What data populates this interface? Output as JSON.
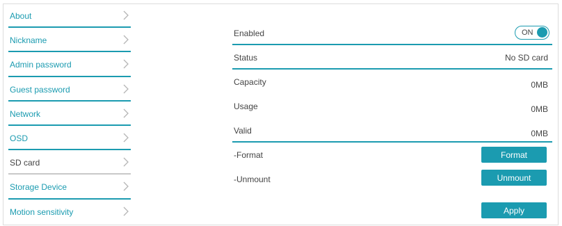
{
  "sidebar": {
    "items": [
      {
        "label": "About",
        "active": false
      },
      {
        "label": "Nickname",
        "active": false
      },
      {
        "label": "Admin password",
        "active": false
      },
      {
        "label": "Guest password",
        "active": false
      },
      {
        "label": "Network",
        "active": false
      },
      {
        "label": "OSD",
        "active": false
      },
      {
        "label": "SD card",
        "active": true
      },
      {
        "label": "Storage Device",
        "active": false
      },
      {
        "label": "Motion sensitivity",
        "active": false
      }
    ]
  },
  "sd_card": {
    "enabled_label": "Enabled",
    "toggle_text": "ON",
    "status_label": "Status",
    "status_value": "No SD card",
    "capacity_label": "Capacity",
    "capacity_value": "0MB",
    "usage_label": "Usage",
    "usage_value": "0MB",
    "valid_label": "Valid",
    "valid_value": "0MB",
    "format_label": "-Format",
    "format_button": "Format",
    "unmount_label": "-Unmount",
    "unmount_button": "Unmount",
    "apply_button": "Apply"
  },
  "colors": {
    "accent": "#1b9bb0",
    "text": "#444444",
    "inactive_divider": "#c8c8c8"
  }
}
